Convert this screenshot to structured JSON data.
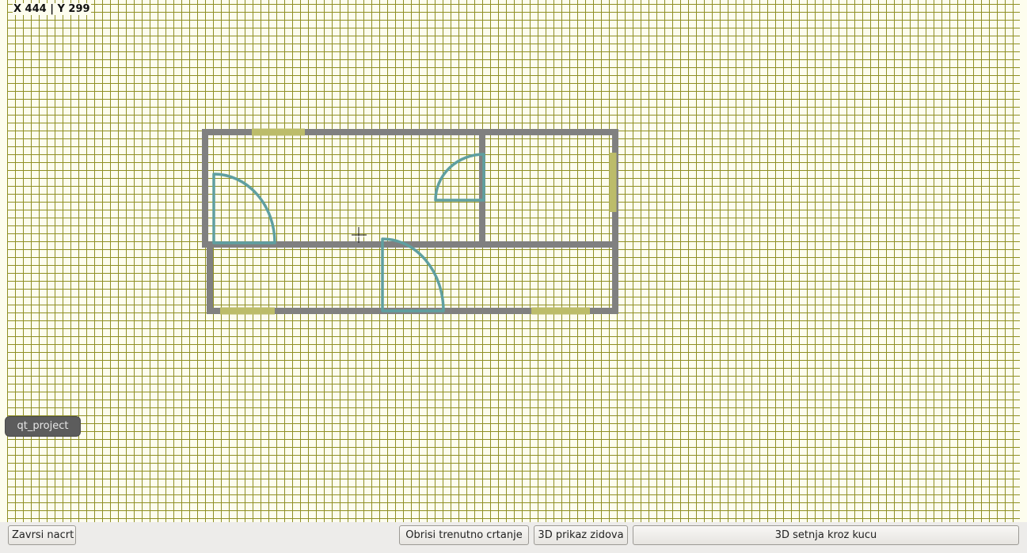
{
  "canvas": {
    "coordinates": "X 444 | Y 299",
    "grid_color": "#8f8f24",
    "wall_color": "#808080",
    "door_color": "#5f9fa0",
    "window_color": "#bcbc6a"
  },
  "tooltip": {
    "text": "qt_project"
  },
  "toolbar": {
    "finish_label": "Zavrsi nacrt",
    "delete_label": "Obrisi trenutno crtanje",
    "walls3d_label": "3D prikaz zidova",
    "walk3d_label": "3D setnja kroz kucu"
  },
  "icons": {
    "cursor": "crosshair-cursor-icon"
  }
}
